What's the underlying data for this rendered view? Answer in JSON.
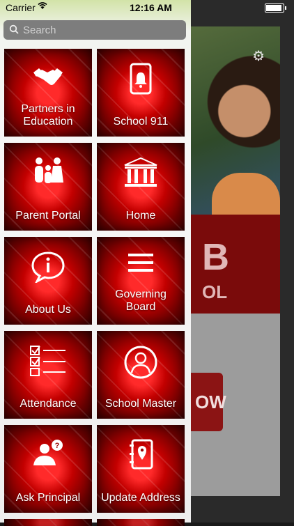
{
  "status_bar": {
    "carrier": "Carrier",
    "time": "12:16 AM"
  },
  "search": {
    "placeholder": "Search"
  },
  "menu": {
    "items": [
      {
        "label": "Partners in Education",
        "icon": "handshake-icon"
      },
      {
        "label": "School 911",
        "icon": "phone-alert-icon"
      },
      {
        "label": "Parent Portal",
        "icon": "family-icon"
      },
      {
        "label": "Home",
        "icon": "building-icon"
      },
      {
        "label": "About Us",
        "icon": "info-bubble-icon"
      },
      {
        "label": "Governing Board",
        "icon": "hamburger-icon"
      },
      {
        "label": "Attendance",
        "icon": "checklist-icon"
      },
      {
        "label": "School Master",
        "icon": "user-icon"
      },
      {
        "label": "Ask Principal",
        "icon": "question-person-icon"
      },
      {
        "label": "Update Address",
        "icon": "address-book-icon"
      }
    ]
  },
  "background": {
    "brand_letter": "B",
    "brand_fragment": "OL",
    "button_fragment": "OW"
  },
  "colors": {
    "tile_red": "#c30000",
    "search_bg": "#7d7d7d"
  }
}
